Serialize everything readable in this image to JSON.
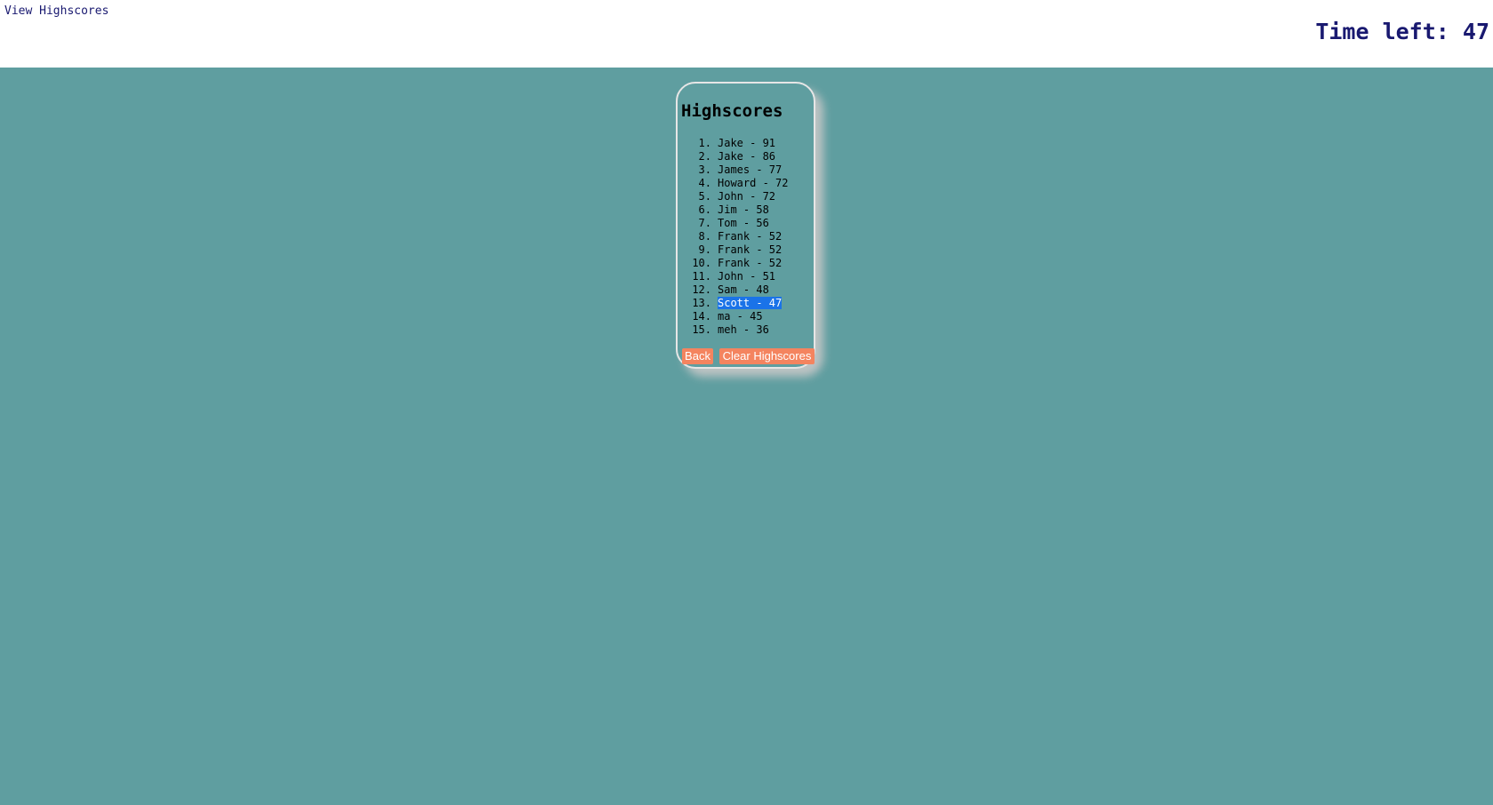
{
  "header": {
    "view_highscores_label": "View Highscores",
    "timer_text": "Time left: 47"
  },
  "highscores": {
    "title": "Highscores",
    "entries": [
      {
        "rank": "1.",
        "text": "Jake - 91",
        "selected": false
      },
      {
        "rank": "2.",
        "text": "Jake - 86",
        "selected": false
      },
      {
        "rank": "3.",
        "text": "James - 77",
        "selected": false
      },
      {
        "rank": "4.",
        "text": "Howard - 72",
        "selected": false
      },
      {
        "rank": "5.",
        "text": "John - 72",
        "selected": false
      },
      {
        "rank": "6.",
        "text": "Jim - 58",
        "selected": false
      },
      {
        "rank": "7.",
        "text": "Tom - 56",
        "selected": false
      },
      {
        "rank": "8.",
        "text": "Frank - 52",
        "selected": false
      },
      {
        "rank": "9.",
        "text": "Frank - 52",
        "selected": false
      },
      {
        "rank": "10.",
        "text": "Frank - 52",
        "selected": false
      },
      {
        "rank": "11.",
        "text": "John - 51",
        "selected": false
      },
      {
        "rank": "12.",
        "text": "Sam - 48",
        "selected": false
      },
      {
        "rank": "13.",
        "text": "Scott - 47",
        "selected": true
      },
      {
        "rank": "14.",
        "text": "ma - 45",
        "selected": false
      },
      {
        "rank": "15.",
        "text": "meh - 36",
        "selected": false
      }
    ],
    "back_label": "Back",
    "clear_label": "Clear Highscores"
  },
  "colors": {
    "page_background": "#5f9ea0",
    "header_background": "#ffffff",
    "header_text": "#191970",
    "button_background": "#f4845f",
    "button_text": "#ffffff",
    "selection_background": "#1a73e8"
  }
}
